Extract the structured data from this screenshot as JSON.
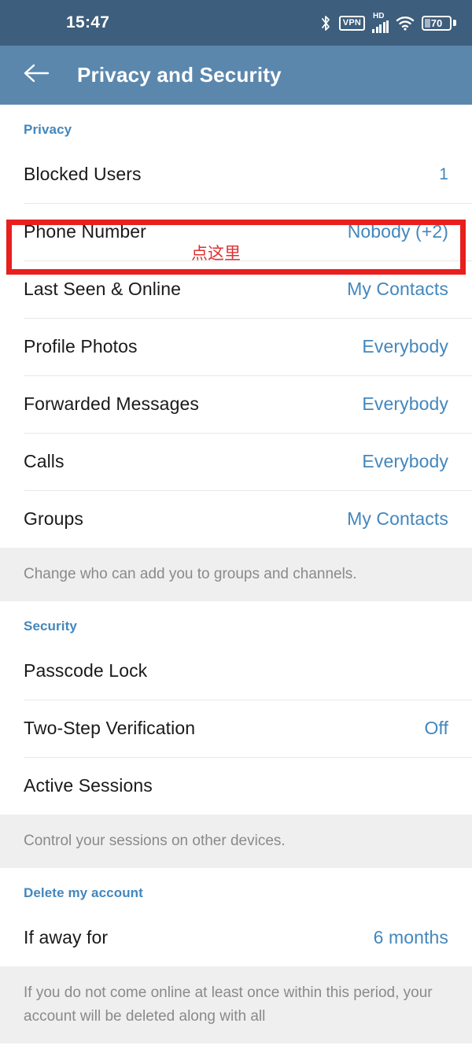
{
  "status_bar": {
    "time": "15:47",
    "icons": [
      {
        "name": "bluetooth-icon",
        "label": "Bluetooth"
      },
      {
        "name": "vpn-icon",
        "label": "VPN"
      },
      {
        "name": "hd-icon",
        "label": "HD"
      },
      {
        "name": "signal-icon",
        "label": "Signal"
      },
      {
        "name": "wifi-icon",
        "label": "Wi-Fi"
      },
      {
        "name": "battery-icon",
        "label": "Battery"
      }
    ],
    "battery_level": "70",
    "background_color": "#3d5e7c"
  },
  "app_bar": {
    "title": "Privacy and Security",
    "back_icon": "arrow-left-icon",
    "background_color": "#5b87ad"
  },
  "colors": {
    "accent": "#4387bd",
    "highlight": "#e81f1f",
    "annotation": "#e03030",
    "footer_bg": "#efefef"
  },
  "sections": [
    {
      "header": "Privacy",
      "rows": [
        {
          "label": "Blocked Users",
          "value": "1",
          "highlighted": false
        },
        {
          "label": "Phone Number",
          "value": "Nobody (+2)",
          "highlighted": true,
          "annotation": "点这里"
        },
        {
          "label": "Last Seen & Online",
          "value": "My Contacts",
          "highlighted": false
        },
        {
          "label": "Profile Photos",
          "value": "Everybody",
          "highlighted": false
        },
        {
          "label": "Forwarded Messages",
          "value": "Everybody",
          "highlighted": false
        },
        {
          "label": "Calls",
          "value": "Everybody",
          "highlighted": false
        },
        {
          "label": "Groups",
          "value": "My Contacts",
          "highlighted": false
        }
      ],
      "footer": "Change who can add you to groups and channels."
    },
    {
      "header": "Security",
      "rows": [
        {
          "label": "Passcode Lock",
          "value": "",
          "highlighted": false
        },
        {
          "label": "Two-Step Verification",
          "value": "Off",
          "highlighted": false
        },
        {
          "label": "Active Sessions",
          "value": "",
          "highlighted": false
        }
      ],
      "footer": "Control your sessions on other devices."
    },
    {
      "header": "Delete my account",
      "rows": [
        {
          "label": "If away for",
          "value": "6 months",
          "highlighted": false
        }
      ],
      "footer": "If you do not come online at least once within this period, your account will be deleted along with all"
    }
  ]
}
